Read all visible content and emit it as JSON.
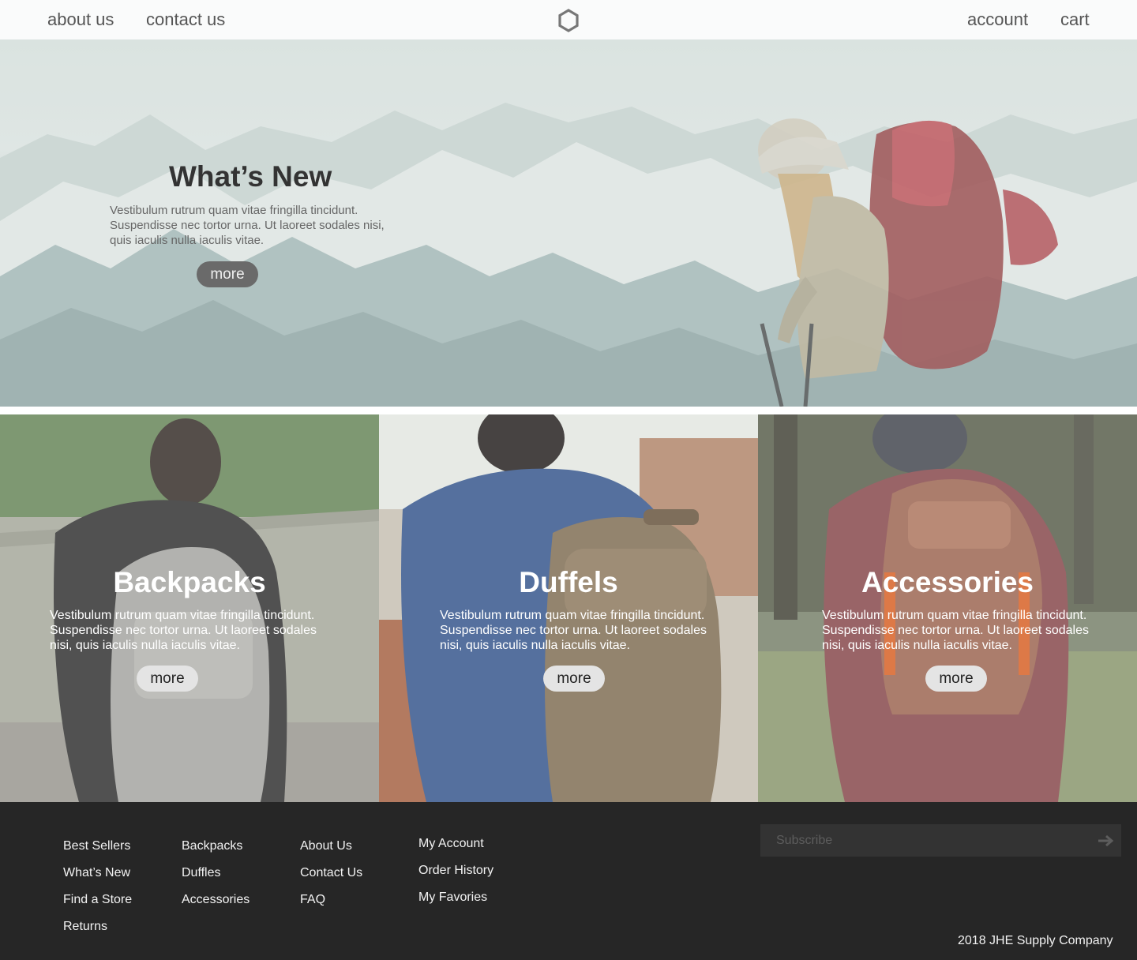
{
  "nav": {
    "left": [
      "about us",
      "contact us"
    ],
    "right": [
      "account",
      "cart"
    ],
    "logo_icon": "hexagon-icon"
  },
  "hero": {
    "title": "What’s New",
    "text": "Vestibulum rutrum quam vitae fringilla tincidunt. Suspendisse nec tortor urna. Ut laoreet sodales nisi, quis iaculis nulla iaculis vitae.",
    "button": "more"
  },
  "categories": [
    {
      "title": "Backpacks",
      "text": "Vestibulum rutrum quam vitae fringilla tincidunt. Suspendisse nec tortor urna. Ut laoreet sodales nisi, quis iaculis nulla iaculis vitae.",
      "button": "more"
    },
    {
      "title": "Duffels",
      "text": "Vestibulum rutrum quam vitae fringilla tincidunt. Suspendisse nec tortor urna. Ut laoreet sodales nisi, quis iaculis nulla iaculis vitae.",
      "button": "more"
    },
    {
      "title": "Accessories",
      "text": "Vestibulum rutrum quam vitae fringilla tincidunt. Suspendisse nec tortor urna. Ut laoreet sodales nisi, quis iaculis nulla iaculis vitae.",
      "button": "more"
    }
  ],
  "footer": {
    "columns": [
      [
        "Best Sellers",
        "What’s New",
        "Find a Store",
        "Returns"
      ],
      [
        "Backpacks",
        "Duffles",
        "Accessories"
      ],
      [
        "About Us",
        "Contact Us",
        "FAQ"
      ],
      [
        "My Account",
        "Order History",
        "My Favories"
      ]
    ],
    "subscribe_placeholder": "Subscribe",
    "subscribe_icon": "arrow-right-icon",
    "copyright": "2018 JHE Supply Company"
  },
  "colors": {
    "nav_bg": "#fafbfb",
    "footer_bg": "#262626",
    "hero_button": "#6a6a6a",
    "tile_button": "#e4e4e4"
  }
}
